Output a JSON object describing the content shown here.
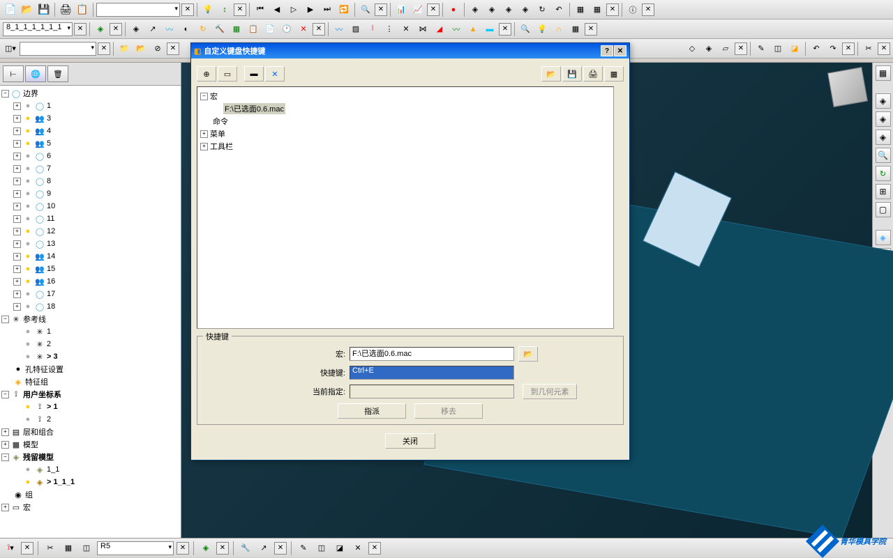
{
  "toolbar1": {
    "dropdown_value": ""
  },
  "toolbar2": {
    "project_name": "8_1_1_1_1_1_1"
  },
  "left_panel": {
    "root": "边界",
    "boundary_items": [
      "1",
      "3",
      "4",
      "5",
      "6",
      "7",
      "8",
      "9",
      "10",
      "11",
      "12",
      "13",
      "14",
      "15",
      "16",
      "17",
      "18"
    ],
    "ref_lines": "参考线",
    "ref_items": [
      "1",
      "2",
      "> 3"
    ],
    "hole_setup": "孔特征设置",
    "feature_group": "特征组",
    "ucs": "用户坐标系",
    "ucs_items": [
      "> 1",
      "2"
    ],
    "layers": "层和组合",
    "model": "模型",
    "residual": "残留模型",
    "res_items": [
      "1_1",
      "> 1_1_1"
    ],
    "group": "组",
    "macro": "宏"
  },
  "dialog": {
    "title": "自定义键盘快捷键",
    "tree": {
      "macro": "宏",
      "macro_file": "F:\\已选面0.6.mac",
      "command": "命令",
      "menu": "菜单",
      "toolbar": "工具栏"
    },
    "shortcut_section": "快捷键",
    "macro_label": "宏:",
    "macro_value": "F:\\已选面0.6.mac",
    "shortcut_label": "快捷键:",
    "shortcut_value": "Ctrl+E",
    "current_label": "当前指定:",
    "current_value": "",
    "goto_element": "到几何元素",
    "assign": "指派",
    "remove": "移去",
    "close": "关闭"
  },
  "status": {
    "text": "R5"
  },
  "watermark": "青华模具学院"
}
